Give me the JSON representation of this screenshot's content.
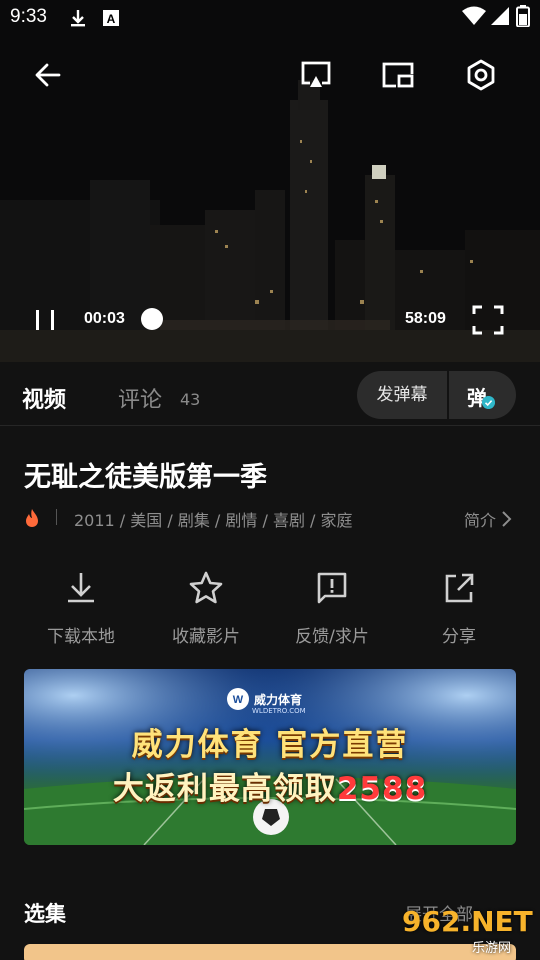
{
  "status_bar": {
    "time": "9:33",
    "left_icons": [
      "download-icon",
      "android-a-icon"
    ],
    "right_icons": [
      "wifi-icon",
      "signal-icon",
      "battery-icon"
    ]
  },
  "player": {
    "top_icons": [
      "back-arrow-icon",
      "cast-icon",
      "pip-icon",
      "settings-icon"
    ],
    "current_time": "00:03",
    "total_time": "58:09",
    "controls": [
      "pause-icon",
      "fullscreen-icon"
    ]
  },
  "tabs": {
    "video": "视频",
    "comments": "评论",
    "comment_count": "43",
    "send_danmu": "发弹幕",
    "danmu_toggle": "弹"
  },
  "info": {
    "title": "无耻之徒美版第一季",
    "meta": "2011 / 美国 / 剧集 / 剧情 / 喜剧 / 家庭",
    "intro_link": "简介"
  },
  "actions": [
    {
      "label": "下载本地",
      "icon": "download-icon"
    },
    {
      "label": "收藏影片",
      "icon": "star-icon"
    },
    {
      "label": "反馈/求片",
      "icon": "feedback-icon"
    },
    {
      "label": "分享",
      "icon": "share-icon"
    }
  ],
  "banner": {
    "brand": "威力体育",
    "brand_sub": "WLDETRO.COM",
    "headline": "威力体育 官方直营",
    "subline_prefix": "大返利最高领取",
    "subline_number": "2588"
  },
  "episodes": {
    "title": "选集",
    "expand_all": "展开全部"
  },
  "watermark": {
    "big": "962.NET",
    "small": "乐游网"
  }
}
